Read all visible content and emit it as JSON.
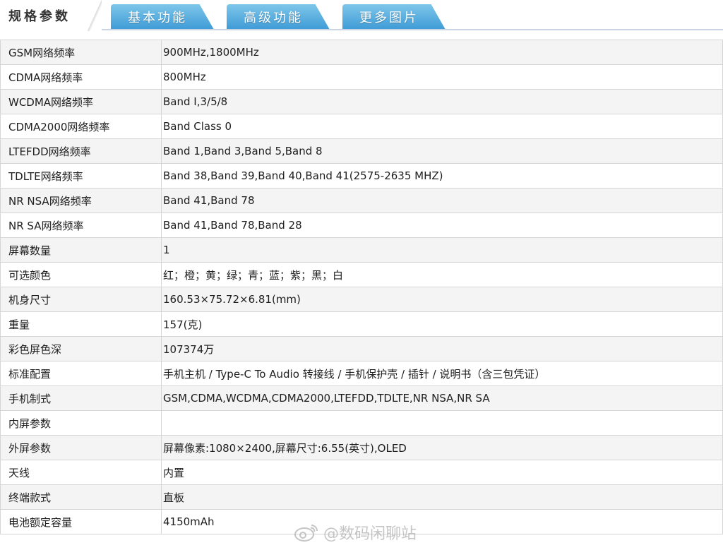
{
  "tabs": [
    {
      "label": "规格参数",
      "active": true
    },
    {
      "label": "基本功能",
      "active": false
    },
    {
      "label": "高级功能",
      "active": false
    },
    {
      "label": "更多图片",
      "active": false
    }
  ],
  "colors": {
    "tab_blue_top": "#7ec6ea",
    "tab_blue_bottom": "#3e9bd6",
    "row_stripe": "#f4f4f4",
    "border": "#d5d5d5"
  },
  "specs": [
    {
      "label": "GSM网络频率",
      "value": "900MHz,1800MHz"
    },
    {
      "label": "CDMA网络频率",
      "value": "800MHz"
    },
    {
      "label": "WCDMA网络频率",
      "value": "Band I,3/5/8"
    },
    {
      "label": "CDMA2000网络频率",
      "value": "Band Class 0"
    },
    {
      "label": "LTEFDD网络频率",
      "value": "Band 1,Band 3,Band 5,Band 8"
    },
    {
      "label": "TDLTE网络频率",
      "value": "Band 38,Band 39,Band 40,Band 41(2575-2635 MHZ)"
    },
    {
      "label": "NR NSA网络频率",
      "value": "Band 41,Band 78"
    },
    {
      "label": "NR SA网络频率",
      "value": "Band 41,Band 78,Band 28"
    },
    {
      "label": "屏幕数量",
      "value": "1"
    },
    {
      "label": "可选颜色",
      "value": "红；橙；黄；绿；青；蓝；紫；黑；白"
    },
    {
      "label": "机身尺寸",
      "value": "160.53×75.72×6.81(mm)"
    },
    {
      "label": "重量",
      "value": "157(克)"
    },
    {
      "label": "彩色屏色深",
      "value": "107374万"
    },
    {
      "label": "标准配置",
      "value": "手机主机 / Type-C To Audio 转接线 / 手机保护壳 / 插针 / 说明书（含三包凭证）"
    },
    {
      "label": "手机制式",
      "value": "GSM,CDMA,WCDMA,CDMA2000,LTEFDD,TDLTE,NR NSA,NR SA"
    },
    {
      "label": "内屏参数",
      "value": ""
    },
    {
      "label": "外屏参数",
      "value": "屏幕像素:1080×2400,屏幕尺寸:6.55(英寸),OLED"
    },
    {
      "label": "天线",
      "value": "内置"
    },
    {
      "label": "终端款式",
      "value": "直板"
    },
    {
      "label": "电池额定容量",
      "value": "4150mAh"
    }
  ],
  "watermark": {
    "text": "@数码闲聊站",
    "icon": "weibo-icon"
  }
}
